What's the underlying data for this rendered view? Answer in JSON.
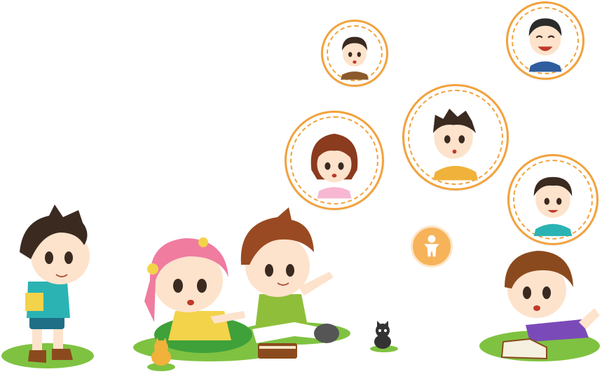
{
  "colors": {
    "accent": "#f2a23c",
    "grass": "#7fc241",
    "skin": "#fde3cc",
    "hair_brown": "#7b4a2a",
    "hair_pink": "#f07ca0"
  },
  "avatars": [
    {
      "name": "boy-avatar-small-top"
    },
    {
      "name": "boy-avatar-laughing"
    },
    {
      "name": "girl-avatar-brown-hair"
    },
    {
      "name": "boy-avatar-center"
    },
    {
      "name": "boy-avatar-right"
    }
  ],
  "badge_icon": "child-figure-icon"
}
